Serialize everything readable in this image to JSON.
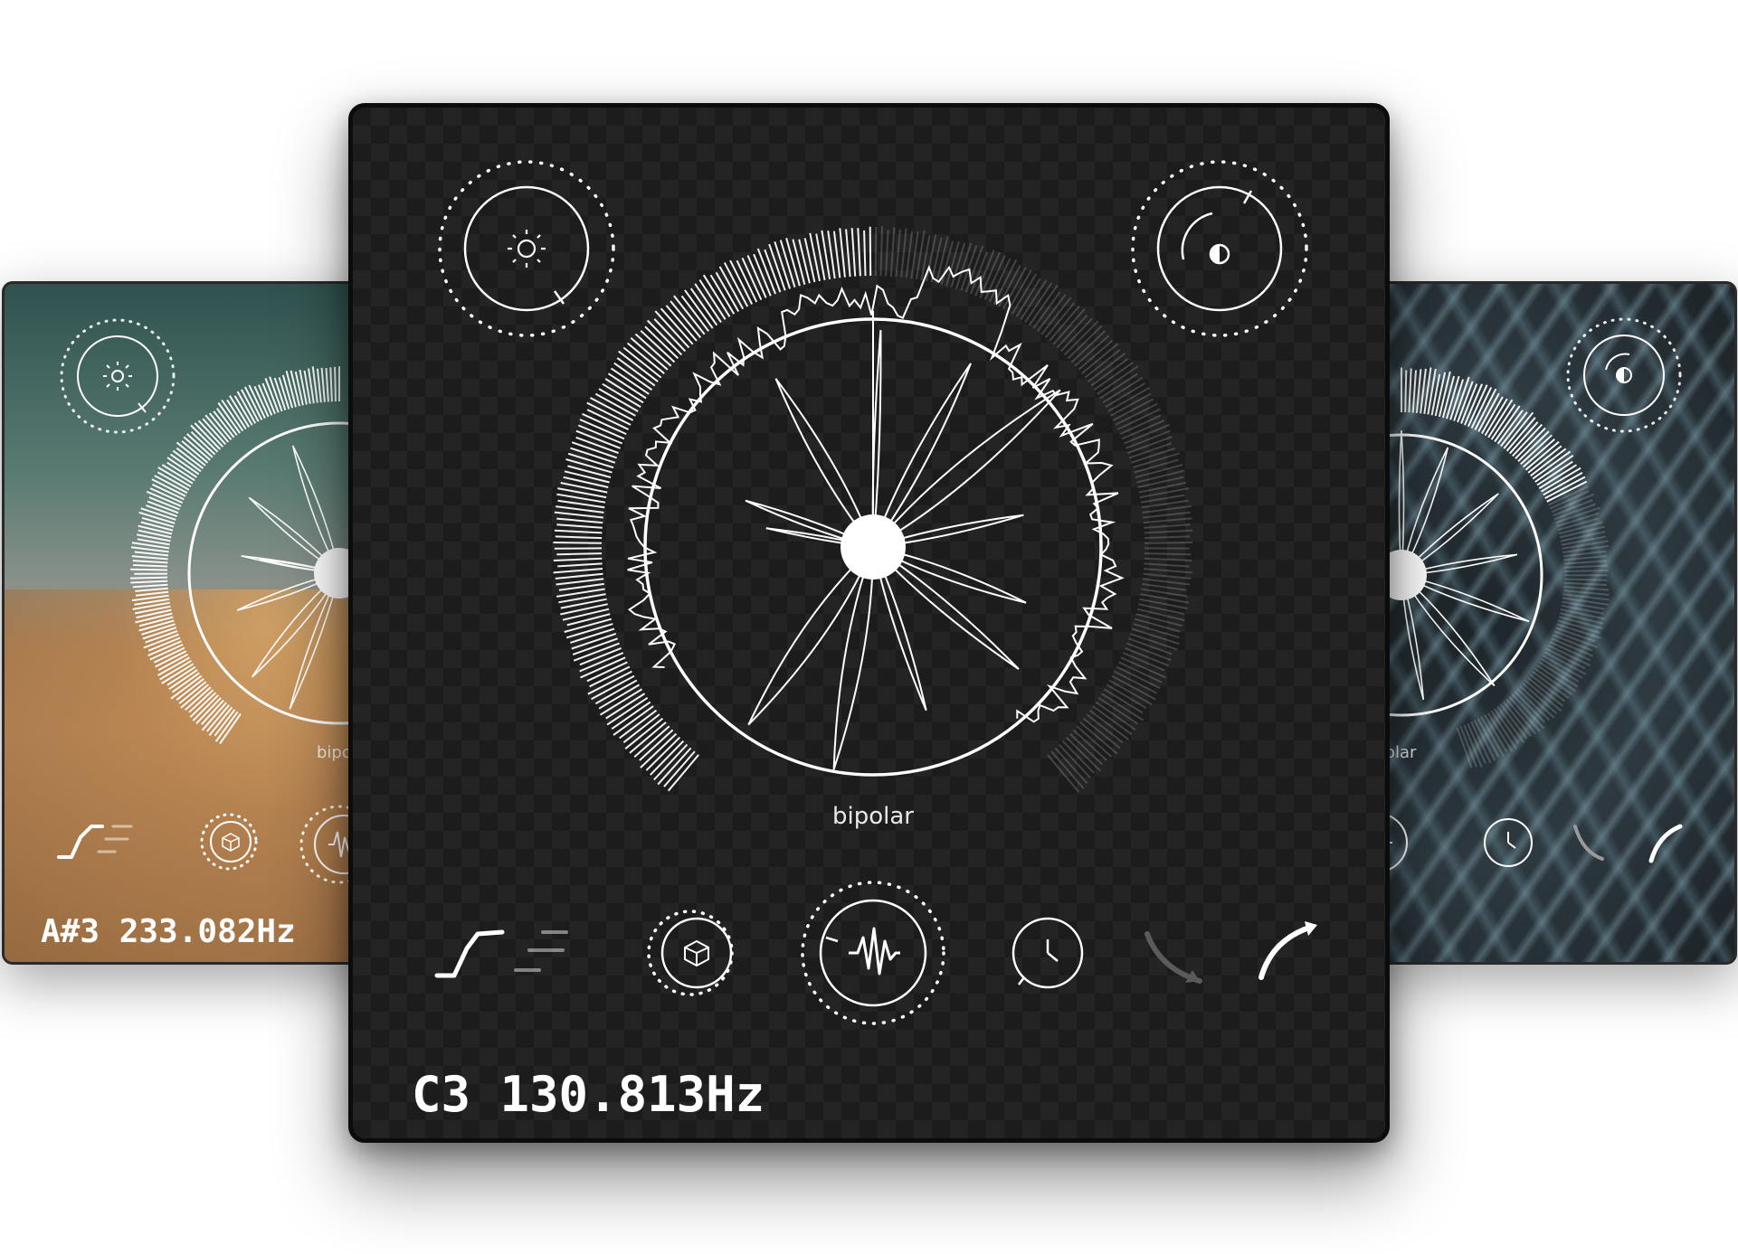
{
  "main_panel": {
    "brand_label": "bipolar",
    "note_readout": "C3 130.813Hz",
    "controls": {
      "brightness_icon": "sun-icon",
      "contrast_icon": "contrast-icon",
      "mode_icons": [
        "staircase-icon",
        "dash-lines-icon",
        "cube-icon",
        "waveform-icon",
        "clock-icon",
        "curve-down-icon",
        "curve-up-icon"
      ]
    }
  },
  "left_panel": {
    "brand_label": "bipo",
    "note_readout": "A#3 233.082Hz"
  },
  "right_panel": {
    "brand_label": "olar"
  },
  "colors": {
    "stroke": "#ffffff",
    "main_bg": "#1c1c1c",
    "dim_stroke": "#5a5a5a"
  }
}
